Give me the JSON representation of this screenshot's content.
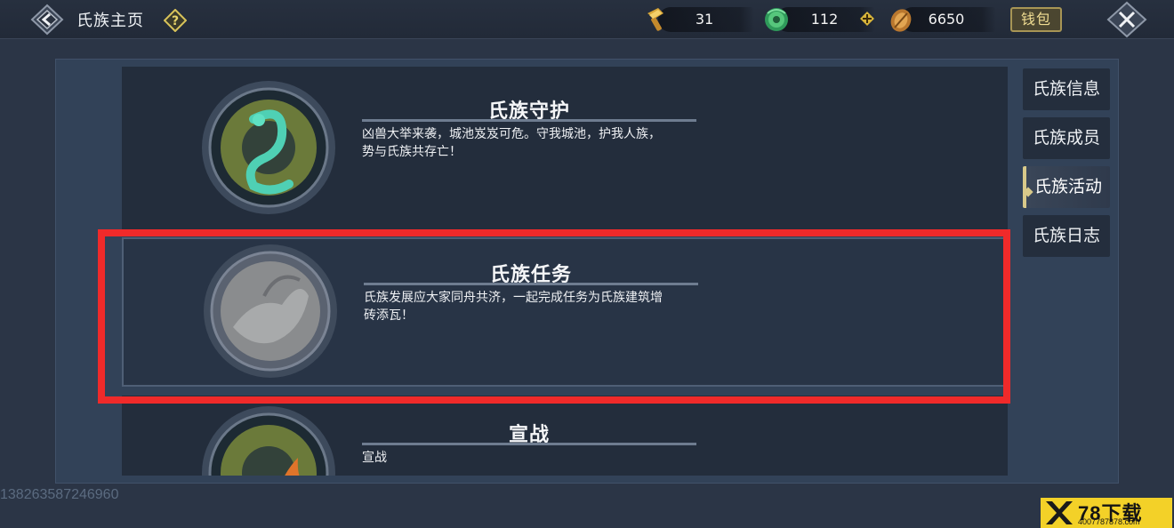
{
  "header": {
    "title": "氏族主页",
    "back_icon": "back-arrow-icon",
    "help_icon": "question-mark-icon",
    "close_icon": "close-x-icon"
  },
  "resources": [
    {
      "name": "hammer",
      "icon": "gold-hammer-icon",
      "value": "31"
    },
    {
      "name": "jade",
      "icon": "jade-coin-icon",
      "value": "112"
    },
    {
      "name": "coin",
      "icon": "copper-coin-icon",
      "value": "6650"
    }
  ],
  "wallet": {
    "label": "钱包"
  },
  "activities": [
    {
      "title": "氏族守护",
      "desc_line1": "凶兽大举来袭，城池岌岌可危。守我城池，护我人族，",
      "desc_line2": "势与氏族共存亡！",
      "emblem": "snake-emblem-icon"
    },
    {
      "title": "氏族任务",
      "desc_line1": "氏族发展应大家同舟共济，一起完成任务为氏族建筑增",
      "desc_line2": "砖添瓦！",
      "emblem": "beast-emblem-icon"
    },
    {
      "title": "宣战",
      "desc_line1": "宣战",
      "desc_line2": "",
      "emblem": "flame-emblem-icon"
    }
  ],
  "tabs": [
    {
      "label": "氏族信息",
      "active": false
    },
    {
      "label": "氏族成员",
      "active": false
    },
    {
      "label": "氏族活动",
      "active": true
    },
    {
      "label": "氏族日志",
      "active": false
    }
  ],
  "footer": {
    "uid": "13826358724696​0",
    "logo_main": "78下载",
    "logo_sub": "4007787878.com"
  },
  "colors": {
    "accent_gold": "#d8c98a",
    "highlight_red": "#f02a2a",
    "panel_bg": "#324258"
  }
}
